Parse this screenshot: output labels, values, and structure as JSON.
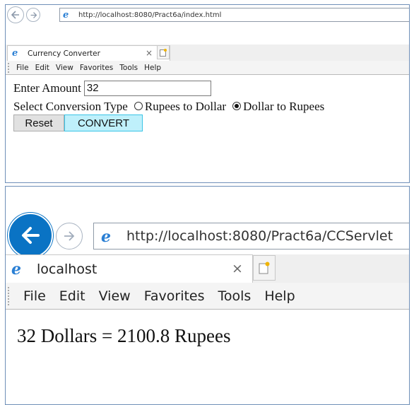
{
  "form_window": {
    "url": "http://localhost:8080/Pract6a/index.html",
    "tab_title": "Currency Converter",
    "tab_close": "×",
    "menu": [
      "File",
      "Edit",
      "View",
      "Favorites",
      "Tools",
      "Help"
    ],
    "amount_label": "Enter Amount",
    "amount_value": "32",
    "conversion_label": "Select Conversion Type",
    "options": [
      {
        "label": "Rupees to Dollar",
        "selected": false
      },
      {
        "label": "Dollar to Rupees",
        "selected": true
      }
    ],
    "reset_label": "Reset",
    "convert_label": "CONVERT"
  },
  "result_window": {
    "url": "http://localhost:8080/Pract6a/CCServlet",
    "tab_title": "localhost",
    "tab_close": "×",
    "menu": [
      "File",
      "Edit",
      "View",
      "Favorites",
      "Tools",
      "Help"
    ],
    "result_text": "32 Dollars = 2100.8 Rupees"
  },
  "colors": {
    "back_button_active": "#0a73c4",
    "convert_button_bg": "#bff0fb",
    "window_border": "#6f8fb8"
  },
  "icons": {
    "back": "back-arrow-icon",
    "forward": "forward-arrow-icon",
    "ie": "internet-explorer-icon",
    "close": "close-icon",
    "new_tab": "new-tab-icon"
  }
}
